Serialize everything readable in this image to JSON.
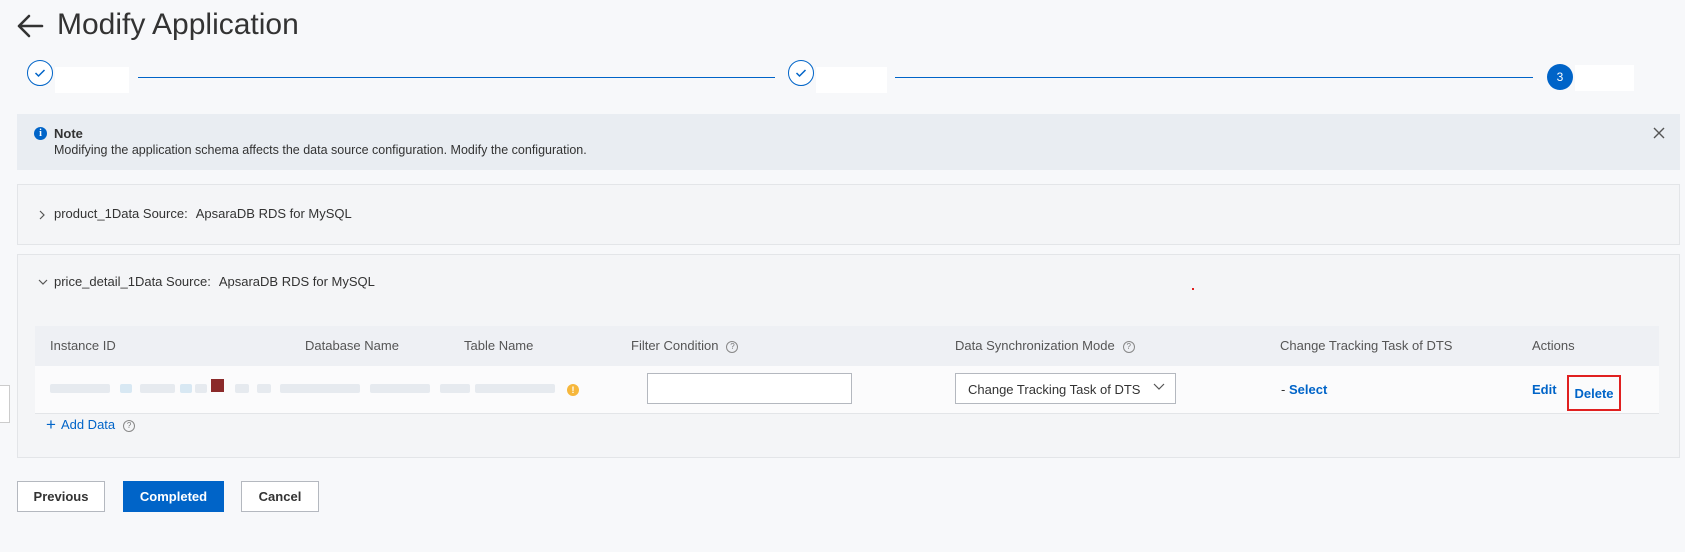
{
  "header": {
    "title": "Modify Application"
  },
  "steps": [
    {
      "state": "done"
    },
    {
      "state": "done"
    },
    {
      "state": "active",
      "number": "3"
    }
  ],
  "note": {
    "title": "Note",
    "text": "Modifying the application schema affects the data source configuration. Modify the configuration."
  },
  "panels": [
    {
      "name": "product_1",
      "source_label": "Data Source:",
      "source": "ApsaraDB RDS for MySQL",
      "expanded": false
    },
    {
      "name": "price_detail_1",
      "source_label": "Data Source:",
      "source": "ApsaraDB RDS for MySQL",
      "expanded": true
    }
  ],
  "table": {
    "columns": [
      "Instance ID",
      "Database Name",
      "Table Name",
      "Filter Condition",
      "Data Synchronization Mode",
      "Change Tracking Task of DTS",
      "Actions"
    ],
    "row": {
      "filter_condition": "",
      "sync_mode": "Change Tracking Task of DTS",
      "dts_task_prefix": "-",
      "dts_task_action": "Select",
      "actions": [
        "Edit",
        "Delete"
      ]
    }
  },
  "add_data_label": "Add Data",
  "footer": {
    "previous": "Previous",
    "completed": "Completed",
    "cancel": "Cancel"
  },
  "colors": {
    "primary": "#0064c8",
    "highlight_border": "#e02020",
    "note_background": "#e9edf2"
  }
}
